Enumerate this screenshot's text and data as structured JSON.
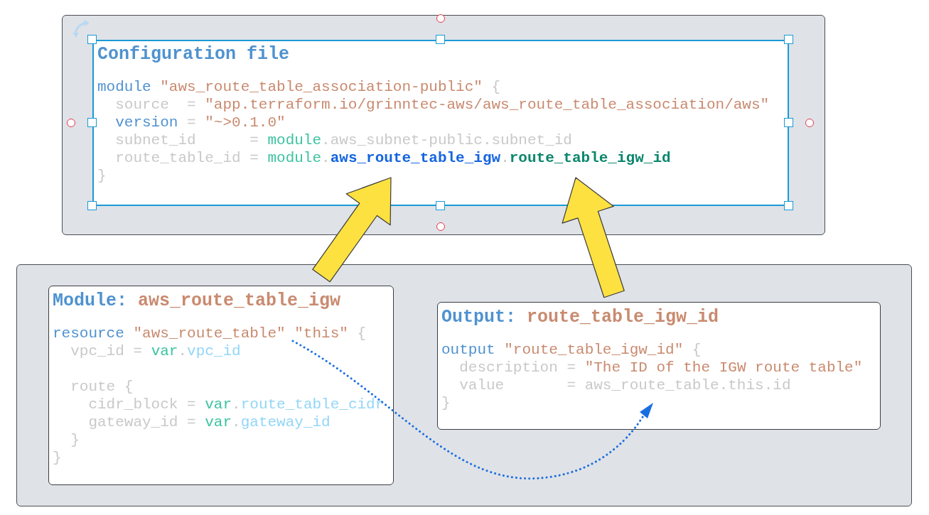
{
  "cards": [
    {
      "selected": true,
      "title": [
        {
          "kind": "label",
          "text": "Configuration file"
        }
      ],
      "blocks": [
        {
          "lines": [
            {
              "tokens": [
                {
                  "kind": "kw",
                  "text": "module "
                },
                {
                  "kind": "str",
                  "text": "\"aws_route_table_association-public\""
                },
                {
                  "kind": "plain",
                  "text": " {"
                }
              ]
            },
            {
              "tokens": [
                {
                  "kind": "plain",
                  "text": "  source  = "
                },
                {
                  "kind": "str",
                  "text": "\"app.terraform.io/grinntec-aws/aws_route_table_association/aws\""
                }
              ]
            },
            {
              "tokens": [
                {
                  "kind": "kw",
                  "text": "  version"
                },
                {
                  "kind": "plain",
                  "text": " = "
                },
                {
                  "kind": "str",
                  "text": "\"~>0.1.0\""
                }
              ]
            },
            {
              "tokens": [
                {
                  "kind": "plain",
                  "text": "  subnet_id      = "
                },
                {
                  "kind": "ref",
                  "text": "module"
                },
                {
                  "kind": "plain",
                  "text": ".aws_subnet-public.subnet_id"
                }
              ]
            },
            {
              "tokens": [
                {
                  "kind": "plain",
                  "text": "  route_table_id = "
                },
                {
                  "kind": "ref",
                  "text": "module"
                },
                {
                  "kind": "plain",
                  "text": "."
                },
                {
                  "kind": "hl_blue",
                  "text": "aws_route_table_igw"
                },
                {
                  "kind": "plain",
                  "text": "."
                },
                {
                  "kind": "hl_green",
                  "text": "route_table_igw_id"
                }
              ]
            },
            {
              "tokens": [
                {
                  "kind": "plain",
                  "text": "}"
                }
              ]
            }
          ]
        }
      ]
    },
    {
      "selected": false,
      "title": [
        {
          "kind": "label",
          "text": "Module: "
        },
        {
          "kind": "name",
          "text": "aws_route_table_igw"
        }
      ],
      "blocks": [
        {
          "lines": [
            {
              "tokens": [
                {
                  "kind": "kw",
                  "text": "resource "
                },
                {
                  "kind": "str",
                  "text": "\"aws_route_table\" \"this\""
                },
                {
                  "kind": "plain",
                  "text": " {"
                }
              ]
            },
            {
              "tokens": [
                {
                  "kind": "plain",
                  "text": "  vpc_id = "
                },
                {
                  "kind": "ref",
                  "text": "var"
                },
                {
                  "kind": "plain",
                  "text": "."
                },
                {
                  "kind": "attr",
                  "text": "vpc_id"
                }
              ]
            }
          ]
        },
        {
          "lines": [
            {
              "tokens": [
                {
                  "kind": "plain",
                  "text": "  route {"
                }
              ]
            },
            {
              "tokens": [
                {
                  "kind": "plain",
                  "text": "    cidr_block = "
                },
                {
                  "kind": "ref",
                  "text": "var"
                },
                {
                  "kind": "plain",
                  "text": "."
                },
                {
                  "kind": "attr",
                  "text": "route_table_cidr"
                }
              ]
            },
            {
              "tokens": [
                {
                  "kind": "plain",
                  "text": "    gateway_id = "
                },
                {
                  "kind": "ref",
                  "text": "var"
                },
                {
                  "kind": "plain",
                  "text": "."
                },
                {
                  "kind": "attr",
                  "text": "gateway_id"
                }
              ]
            },
            {
              "tokens": [
                {
                  "kind": "plain",
                  "text": "  }"
                }
              ]
            },
            {
              "tokens": [
                {
                  "kind": "plain",
                  "text": "}"
                }
              ]
            }
          ]
        }
      ]
    },
    {
      "selected": false,
      "title": [
        {
          "kind": "label",
          "text": "Output: "
        },
        {
          "kind": "name",
          "text": "route_table_igw_id"
        }
      ],
      "blocks": [
        {
          "lines": [
            {
              "tokens": [
                {
                  "kind": "kw",
                  "text": "output "
                },
                {
                  "kind": "str",
                  "text": "\"route_table_igw_id\""
                },
                {
                  "kind": "plain",
                  "text": " {"
                }
              ]
            },
            {
              "tokens": [
                {
                  "kind": "plain",
                  "text": "  description = "
                },
                {
                  "kind": "str",
                  "text": "\"The ID of the IGW route table\""
                }
              ]
            },
            {
              "tokens": [
                {
                  "kind": "plain",
                  "text": "  value       = aws_route_table.this.id"
                }
              ]
            },
            {
              "tokens": [
                {
                  "kind": "plain",
                  "text": "}"
                }
              ]
            }
          ]
        }
      ]
    }
  ]
}
